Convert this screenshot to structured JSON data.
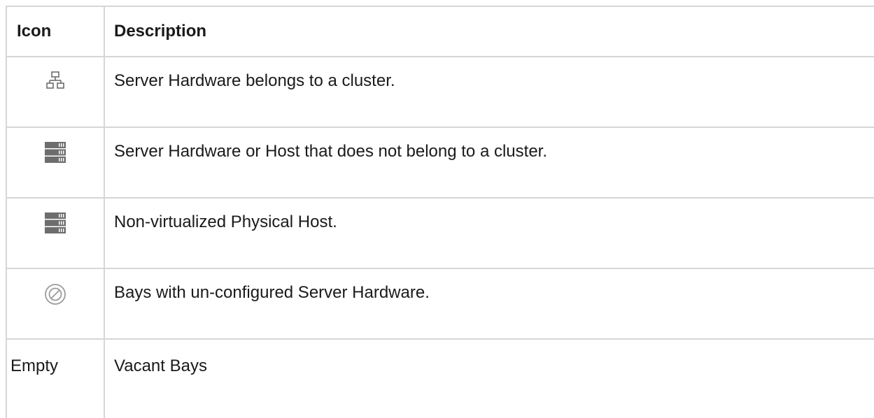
{
  "header": {
    "icon_label": "Icon",
    "description_label": "Description"
  },
  "rows": [
    {
      "icon": "cluster-network-icon",
      "description": "Server Hardware belongs to a cluster."
    },
    {
      "icon": "server-rack-icon",
      "description": "Server Hardware or Host that does not belong to a cluster."
    },
    {
      "icon": "server-rack-icon",
      "description": "Non-virtualized Physical Host."
    },
    {
      "icon": "unconfigured-prohibited-icon",
      "description": "Bays with un-configured Server Hardware."
    },
    {
      "icon_text": "Empty",
      "description": "Vacant Bays"
    }
  ],
  "colors": {
    "border": "#d6d6d6",
    "icon_gray": "#6d6d6d"
  }
}
